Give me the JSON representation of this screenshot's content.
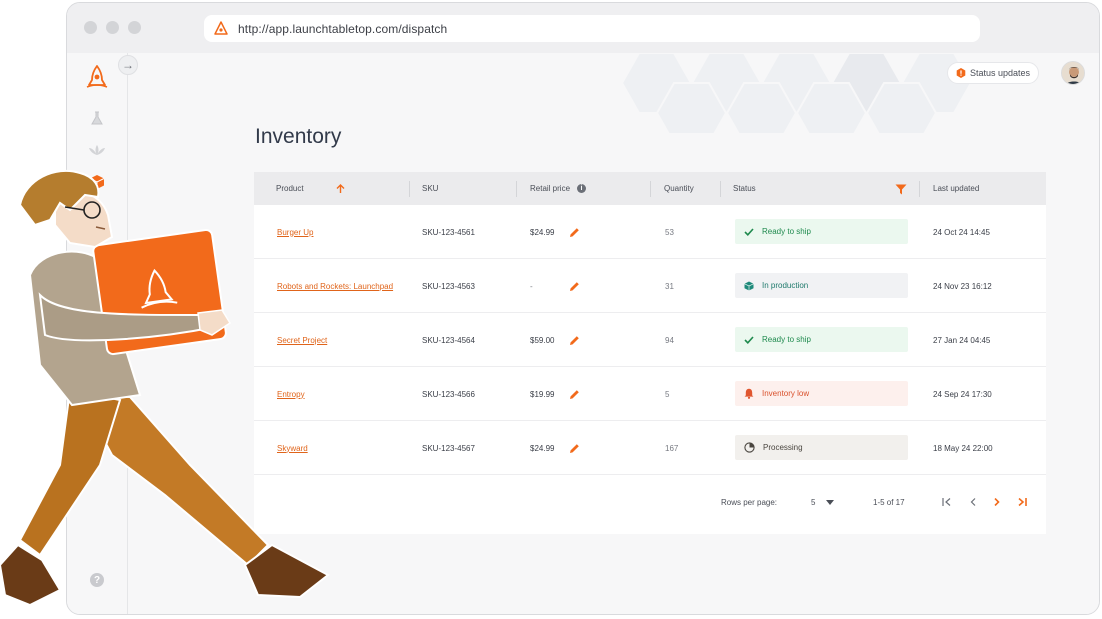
{
  "browser": {
    "url": "http://app.launchtabletop.com/dispatch"
  },
  "header": {
    "status_updates_label": "Status updates"
  },
  "page": {
    "title": "Inventory"
  },
  "table": {
    "columns": {
      "product": "Product",
      "sku": "SKU",
      "retail_price": "Retail price",
      "quantity": "Quantity",
      "status": "Status",
      "last_updated": "Last updated"
    },
    "rows": [
      {
        "product": "Burger Up",
        "sku": "SKU-123-4561",
        "price": "$24.99",
        "quantity": "53",
        "status": "Ready to ship",
        "status_kind": "ready",
        "updated": "24 Oct 24 14:45"
      },
      {
        "product": "Robots and Rockets: Launchpad",
        "sku": "SKU-123-4563",
        "price": "-",
        "quantity": "31",
        "status": "In production",
        "status_kind": "production",
        "updated": "24 Nov 23 16:12"
      },
      {
        "product": "Secret Project",
        "sku": "SKU-123-4564",
        "price": "$59.00",
        "quantity": "94",
        "status": "Ready to ship",
        "status_kind": "ready",
        "updated": "27 Jan 24 04:45"
      },
      {
        "product": "Entropy",
        "sku": "SKU-123-4566",
        "price": "$19.99",
        "quantity": "5",
        "status": "Inventory low",
        "status_kind": "low",
        "updated": "24 Sep 24 17:30"
      },
      {
        "product": "Skyward",
        "sku": "SKU-123-4567",
        "price": "$24.99",
        "quantity": "167",
        "status": "Processing",
        "status_kind": "processing",
        "updated": "18 May 24 22:00"
      }
    ]
  },
  "pagination": {
    "rows_per_page_label": "Rows per page:",
    "rows_per_page_value": "5",
    "range_label": "1-5 of 17"
  },
  "colors": {
    "accent": "#f26a1b",
    "ready": "#1f8a4e",
    "low": "#d9512c"
  },
  "icons": {
    "logo": "rocket-logo-icon",
    "nav": [
      "flask-icon",
      "lotus-icon",
      "box-icon"
    ],
    "help": "question-icon"
  }
}
